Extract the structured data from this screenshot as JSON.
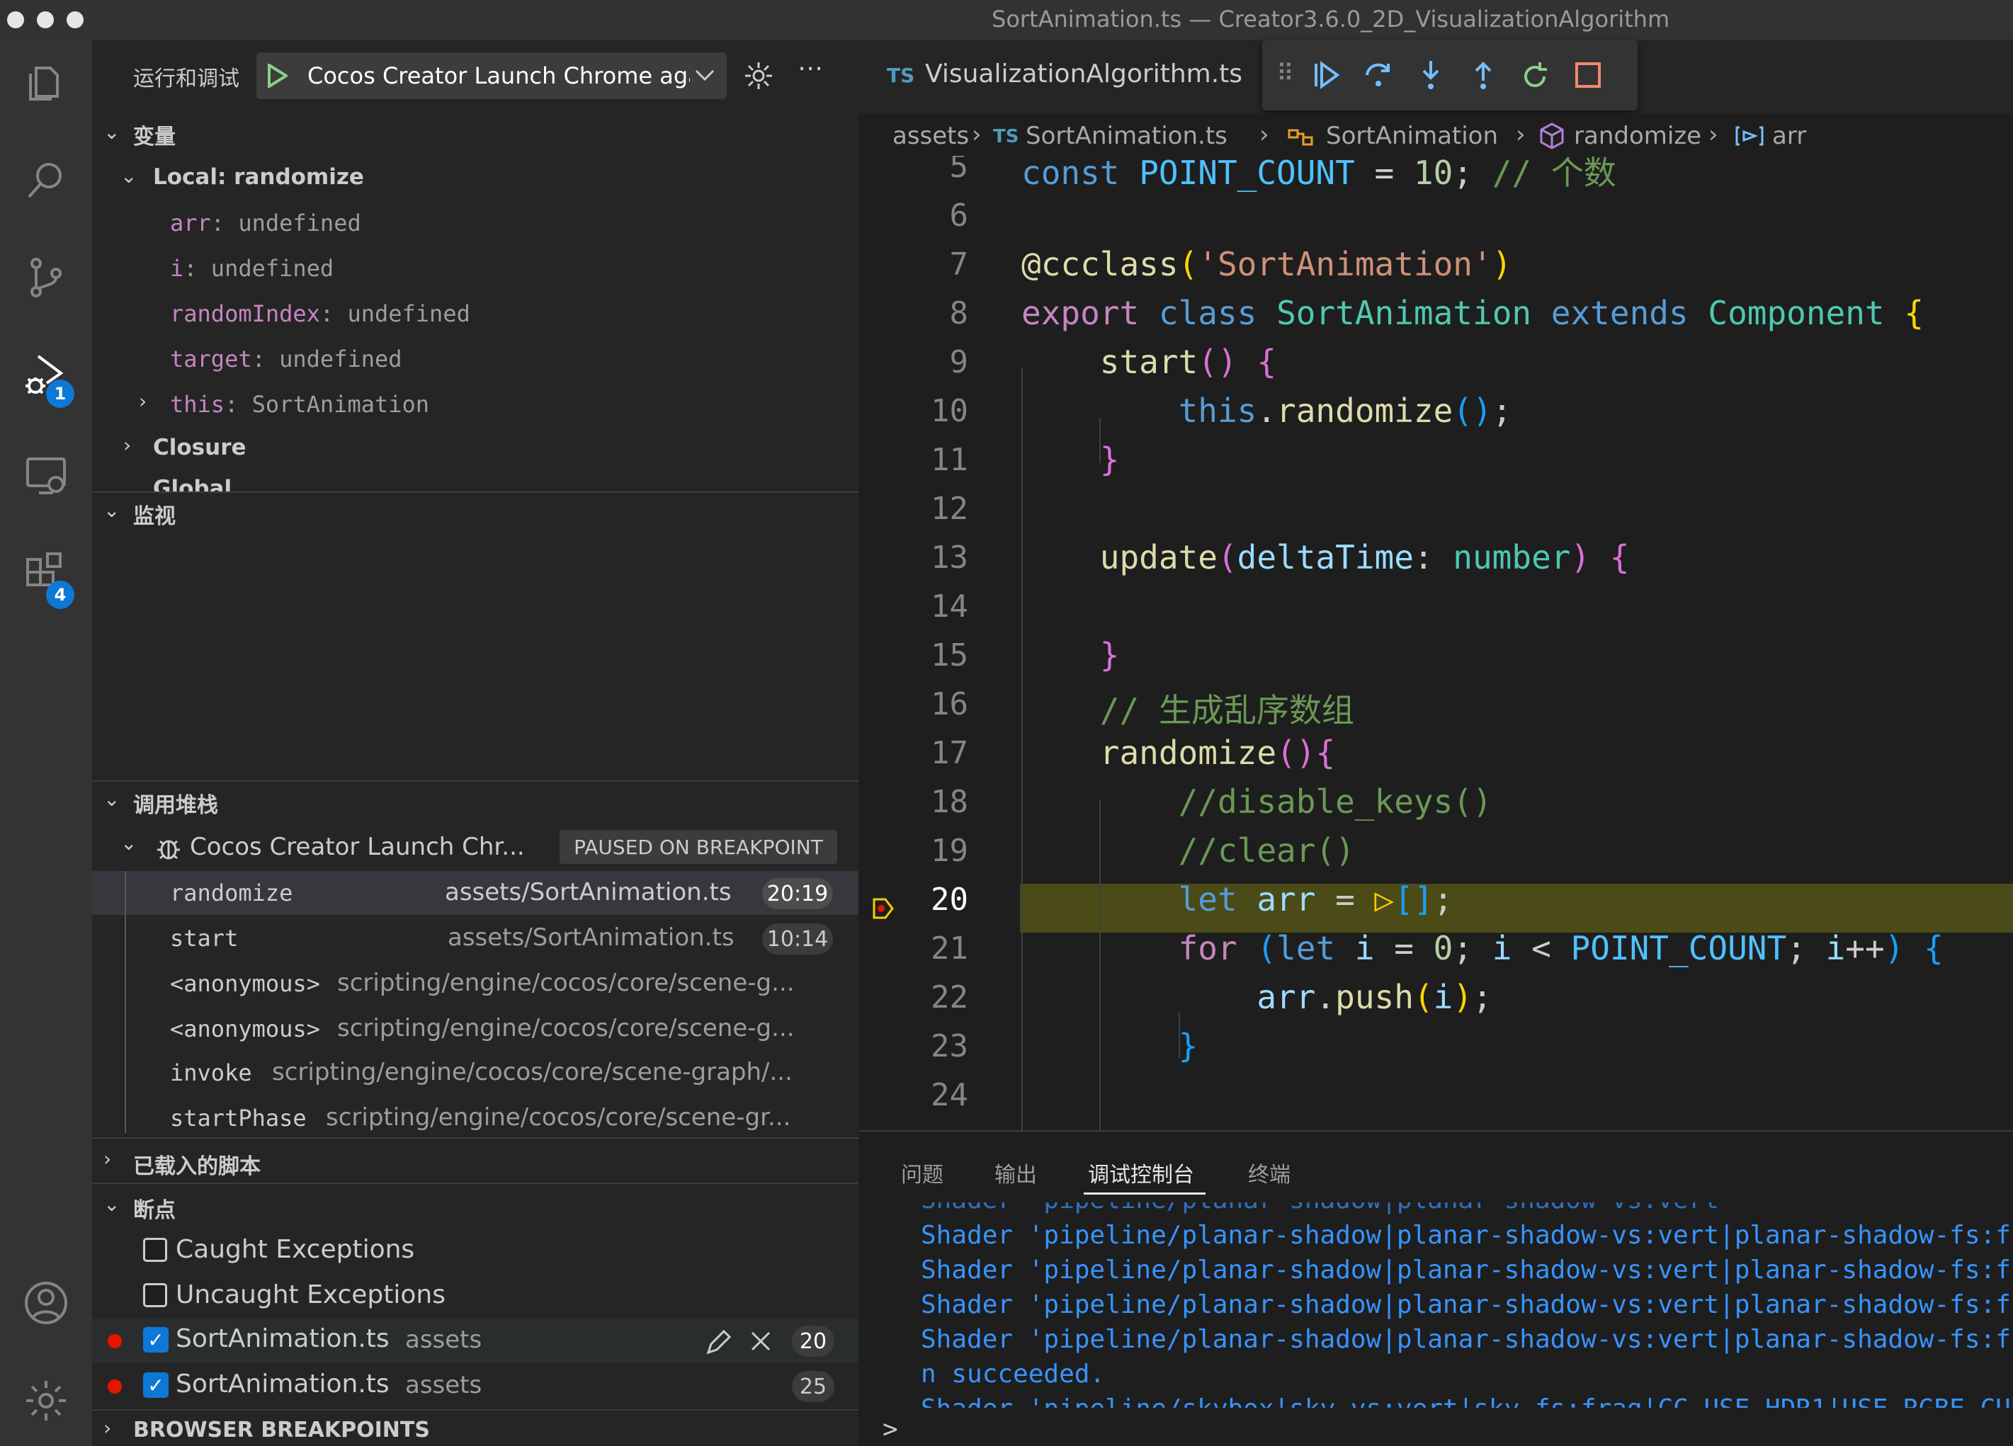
{
  "window": {
    "title": "SortAnimation.ts — Creator3.6.0_2D_VisualizationAlgorithm"
  },
  "activity_bar": {
    "debug_badge": "1",
    "extensions_badge": "4"
  },
  "sidebar": {
    "header": "运行和调试",
    "launch_config": "Cocos Creator Launch Chrome aga",
    "variables": {
      "title": "变量",
      "scope_local": "Local: randomize",
      "items": [
        {
          "name": "arr",
          "value": "undefined"
        },
        {
          "name": "i",
          "value": "undefined"
        },
        {
          "name": "randomIndex",
          "value": "undefined"
        },
        {
          "name": "target",
          "value": "undefined"
        },
        {
          "name": "this",
          "value": "SortAnimation"
        }
      ],
      "scope_closure": "Closure",
      "scope_global": "Global"
    },
    "watch": {
      "title": "监视"
    },
    "callstack": {
      "title": "调用堆栈",
      "session": "Cocos Creator Launch Chr...",
      "status": "PAUSED ON BREAKPOINT",
      "frames": [
        {
          "name": "randomize",
          "file": "assets/SortAnimation.ts",
          "pos": "20:19"
        },
        {
          "name": "start",
          "file": "assets/SortAnimation.ts",
          "pos": "10:14"
        },
        {
          "name": "<anonymous>",
          "file": "scripting/engine/cocos/core/scene-g...",
          "pos": ""
        },
        {
          "name": "<anonymous>",
          "file": "scripting/engine/cocos/core/scene-g...",
          "pos": ""
        },
        {
          "name": "invoke",
          "file": "scripting/engine/cocos/core/scene-graph/...",
          "pos": ""
        },
        {
          "name": "startPhase",
          "file": "scripting/engine/cocos/core/scene-gr...",
          "pos": ""
        }
      ]
    },
    "loaded_scripts": {
      "title": "已载入的脚本"
    },
    "breakpoints": {
      "title": "断点",
      "caught": "Caught Exceptions",
      "uncaught": "Uncaught Exceptions",
      "items": [
        {
          "file": "SortAnimation.ts",
          "dir": "assets",
          "line": "20"
        },
        {
          "file": "SortAnimation.ts",
          "dir": "assets",
          "line": "25"
        }
      ]
    },
    "browser_breakpoints": {
      "title": "BROWSER BREAKPOINTS"
    }
  },
  "editor": {
    "tab": {
      "lang": "TS",
      "name": "VisualizationAlgorithm.ts"
    },
    "breadcrumb": {
      "folder": "assets",
      "lang": "TS",
      "file": "SortAnimation.ts",
      "class": "SortAnimation",
      "method": "randomize",
      "symbol": "arr"
    },
    "line_numbers": [
      "5",
      "6",
      "7",
      "8",
      "9",
      "10",
      "11",
      "12",
      "13",
      "14",
      "15",
      "16",
      "17",
      "18",
      "19",
      "20",
      "21",
      "22",
      "23",
      "24"
    ],
    "current_line": "20"
  },
  "panel": {
    "tabs": [
      "问题",
      "输出",
      "调试控制台",
      "终端"
    ],
    "active_tab": "调试控制台",
    "console": [
      "Shader 'pipeline/planar-shadow|planar-shadow-vs:vert|planar-shadow-fs:frag",
      "Shader 'pipeline/planar-shadow|planar-shadow-vs:vert|planar-shadow-fs:frag",
      "Shader 'pipeline/planar-shadow|planar-shadow-vs:vert|planar-shadow-fs:frag",
      "Shader 'pipeline/planar-shadow|planar-shadow-vs:vert|planar-shadow-fs:frag",
      "n succeeded.",
      "Shader 'pipeline/skybox|sky-vs:vert|sky-fs:frag|CC_USE_HDR1|USE_RGBE_CUBEMA"
    ],
    "prompt": ">"
  },
  "colors": {
    "accent": "#0e78d6",
    "breakpoint": "#e51400",
    "current_line_bg": "#4b4b18",
    "debug_green": "#89d185"
  }
}
